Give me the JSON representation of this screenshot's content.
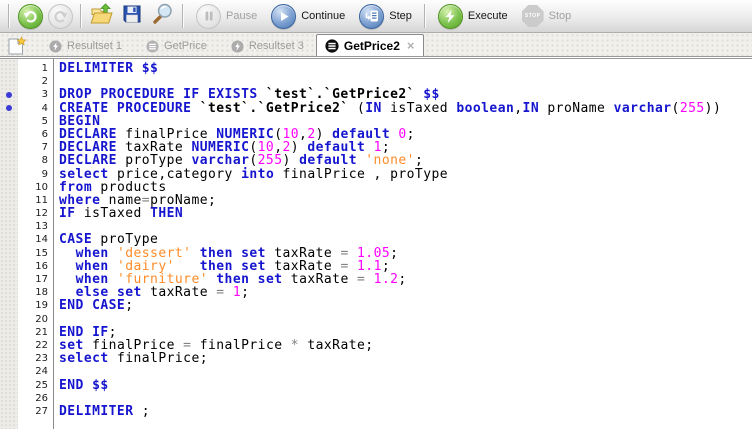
{
  "toolbar": {
    "undo": {
      "icon": "undo-arrow-icon",
      "enabled": true
    },
    "redo": {
      "icon": "redo-arrow-icon",
      "enabled": false
    },
    "open": {
      "icon": "open-folder-icon",
      "enabled": true
    },
    "save": {
      "icon": "save-floppy-icon",
      "enabled": true
    },
    "search": {
      "icon": "magnifier-icon",
      "enabled": true
    },
    "pause": {
      "label": "Pause",
      "enabled": false
    },
    "continue": {
      "label": "Continue",
      "enabled": true
    },
    "step": {
      "label": "Step",
      "enabled": true
    },
    "execute": {
      "label": "Execute",
      "enabled": true
    },
    "stop": {
      "label": "Stop",
      "enabled": false
    }
  },
  "tabbar": {
    "new_tab_icon": "new-script-icon",
    "close_glyph": "×",
    "tabs": [
      {
        "label": "Resultset 1",
        "icon": "resultset-icon",
        "active": false
      },
      {
        "label": "GetPrice",
        "icon": "procedure-icon",
        "active": false
      },
      {
        "label": "Resultset 3",
        "icon": "resultset-icon",
        "active": false
      },
      {
        "label": "GetPrice2",
        "icon": "procedure-icon",
        "active": true,
        "closable": true
      }
    ]
  },
  "colors": {
    "keyword": "#1515cf",
    "number": "#ff00ff",
    "string": "#ff8c28",
    "operator": "#808080",
    "breakpoint": "#3a3ad6",
    "execute_green": "#55a326",
    "action_blue": "#4a77b4"
  },
  "editor": {
    "language": "sql",
    "breakpoint_lines": [
      3,
      4
    ],
    "lines": [
      {
        "n": 1,
        "segs": [
          [
            "kw",
            "DELIMITER"
          ],
          [
            "pl",
            " "
          ],
          [
            "kw",
            "$$"
          ]
        ]
      },
      {
        "n": 2,
        "segs": []
      },
      {
        "n": 3,
        "segs": [
          [
            "kw",
            "DROP PROCEDURE IF EXISTS"
          ],
          [
            "pl",
            " "
          ],
          [
            "tick",
            "`test`.`GetPrice2`"
          ],
          [
            "pl",
            " "
          ],
          [
            "kw",
            "$$"
          ]
        ]
      },
      {
        "n": 4,
        "segs": [
          [
            "kw",
            "CREATE PROCEDURE"
          ],
          [
            "pl",
            " "
          ],
          [
            "tick",
            "`test`.`GetPrice2`"
          ],
          [
            "pl",
            " ("
          ],
          [
            "kw",
            "IN"
          ],
          [
            "pl",
            " isTaxed "
          ],
          [
            "kw",
            "boolean"
          ],
          [
            "pl",
            ","
          ],
          [
            "kw",
            "IN"
          ],
          [
            "pl",
            " proName "
          ],
          [
            "kw",
            "varchar"
          ],
          [
            "pl",
            "("
          ],
          [
            "num",
            "255"
          ],
          [
            "pl",
            "))"
          ]
        ]
      },
      {
        "n": 5,
        "segs": [
          [
            "kw",
            "BEGIN"
          ]
        ]
      },
      {
        "n": 6,
        "segs": [
          [
            "kw",
            "DECLARE"
          ],
          [
            "pl",
            " finalPrice "
          ],
          [
            "kw",
            "NUMERIC"
          ],
          [
            "pl",
            "("
          ],
          [
            "num",
            "10"
          ],
          [
            "pl",
            ","
          ],
          [
            "num",
            "2"
          ],
          [
            "pl",
            ") "
          ],
          [
            "kw",
            "default"
          ],
          [
            "pl",
            " "
          ],
          [
            "num",
            "0"
          ],
          [
            "pl",
            ";"
          ]
        ]
      },
      {
        "n": 7,
        "segs": [
          [
            "kw",
            "DECLARE"
          ],
          [
            "pl",
            " taxRate "
          ],
          [
            "kw",
            "NUMERIC"
          ],
          [
            "pl",
            "("
          ],
          [
            "num",
            "10"
          ],
          [
            "pl",
            ","
          ],
          [
            "num",
            "2"
          ],
          [
            "pl",
            ") "
          ],
          [
            "kw",
            "default"
          ],
          [
            "pl",
            " "
          ],
          [
            "num",
            "1"
          ],
          [
            "pl",
            ";"
          ]
        ]
      },
      {
        "n": 8,
        "segs": [
          [
            "kw",
            "DECLARE"
          ],
          [
            "pl",
            " proType "
          ],
          [
            "kw",
            "varchar"
          ],
          [
            "pl",
            "("
          ],
          [
            "num",
            "255"
          ],
          [
            "pl",
            ") "
          ],
          [
            "kw",
            "default"
          ],
          [
            "pl",
            " "
          ],
          [
            "str",
            "'none'"
          ],
          [
            "pl",
            ";"
          ]
        ]
      },
      {
        "n": 9,
        "segs": [
          [
            "kw",
            "select"
          ],
          [
            "pl",
            " price,category "
          ],
          [
            "kw",
            "into"
          ],
          [
            "pl",
            " finalPrice , proType"
          ]
        ]
      },
      {
        "n": 10,
        "segs": [
          [
            "kw",
            "from"
          ],
          [
            "pl",
            " products"
          ]
        ]
      },
      {
        "n": 11,
        "segs": [
          [
            "kw",
            "where"
          ],
          [
            "pl",
            " name"
          ],
          [
            "op",
            "="
          ],
          [
            "pl",
            "proName;"
          ]
        ]
      },
      {
        "n": 12,
        "segs": [
          [
            "kw",
            "IF"
          ],
          [
            "pl",
            " isTaxed "
          ],
          [
            "kw",
            "THEN"
          ]
        ]
      },
      {
        "n": 13,
        "segs": []
      },
      {
        "n": 14,
        "segs": [
          [
            "kw",
            "CASE"
          ],
          [
            "pl",
            " proType"
          ]
        ]
      },
      {
        "n": 15,
        "segs": [
          [
            "pl",
            "  "
          ],
          [
            "kw",
            "when"
          ],
          [
            "pl",
            " "
          ],
          [
            "str",
            "'dessert'"
          ],
          [
            "pl",
            " "
          ],
          [
            "kw",
            "then"
          ],
          [
            "pl",
            " "
          ],
          [
            "kw",
            "set"
          ],
          [
            "pl",
            " taxRate "
          ],
          [
            "op",
            "="
          ],
          [
            "pl",
            " "
          ],
          [
            "num",
            "1.05"
          ],
          [
            "pl",
            ";"
          ]
        ]
      },
      {
        "n": 16,
        "segs": [
          [
            "pl",
            "  "
          ],
          [
            "kw",
            "when"
          ],
          [
            "pl",
            " "
          ],
          [
            "str",
            "'dairy'"
          ],
          [
            "pl",
            "   "
          ],
          [
            "kw",
            "then"
          ],
          [
            "pl",
            " "
          ],
          [
            "kw",
            "set"
          ],
          [
            "pl",
            " taxRate "
          ],
          [
            "op",
            "="
          ],
          [
            "pl",
            " "
          ],
          [
            "num",
            "1.1"
          ],
          [
            "pl",
            ";"
          ]
        ]
      },
      {
        "n": 17,
        "segs": [
          [
            "pl",
            "  "
          ],
          [
            "kw",
            "when"
          ],
          [
            "pl",
            " "
          ],
          [
            "str",
            "'furniture'"
          ],
          [
            "pl",
            " "
          ],
          [
            "kw",
            "then"
          ],
          [
            "pl",
            " "
          ],
          [
            "kw",
            "set"
          ],
          [
            "pl",
            " taxRate "
          ],
          [
            "op",
            "="
          ],
          [
            "pl",
            " "
          ],
          [
            "num",
            "1.2"
          ],
          [
            "pl",
            ";"
          ]
        ]
      },
      {
        "n": 18,
        "segs": [
          [
            "pl",
            "  "
          ],
          [
            "kw",
            "else"
          ],
          [
            "pl",
            " "
          ],
          [
            "kw",
            "set"
          ],
          [
            "pl",
            " taxRate "
          ],
          [
            "op",
            "="
          ],
          [
            "pl",
            " "
          ],
          [
            "num",
            "1"
          ],
          [
            "pl",
            ";"
          ]
        ]
      },
      {
        "n": 19,
        "segs": [
          [
            "kw",
            "END CASE"
          ],
          [
            "pl",
            ";"
          ]
        ]
      },
      {
        "n": 20,
        "segs": []
      },
      {
        "n": 21,
        "segs": [
          [
            "kw",
            "END IF"
          ],
          [
            "pl",
            ";"
          ]
        ]
      },
      {
        "n": 22,
        "segs": [
          [
            "kw",
            "set"
          ],
          [
            "pl",
            " finalPrice "
          ],
          [
            "op",
            "="
          ],
          [
            "pl",
            " finalPrice "
          ],
          [
            "op",
            "*"
          ],
          [
            "pl",
            " taxRate;"
          ]
        ]
      },
      {
        "n": 23,
        "segs": [
          [
            "kw",
            "select"
          ],
          [
            "pl",
            " finalPrice;"
          ]
        ]
      },
      {
        "n": 24,
        "segs": []
      },
      {
        "n": 25,
        "segs": [
          [
            "kw",
            "END"
          ],
          [
            "pl",
            " "
          ],
          [
            "kw",
            "$$"
          ]
        ]
      },
      {
        "n": 26,
        "segs": []
      },
      {
        "n": 27,
        "segs": [
          [
            "kw",
            "DELIMITER"
          ],
          [
            "pl",
            " ;"
          ]
        ]
      }
    ]
  }
}
